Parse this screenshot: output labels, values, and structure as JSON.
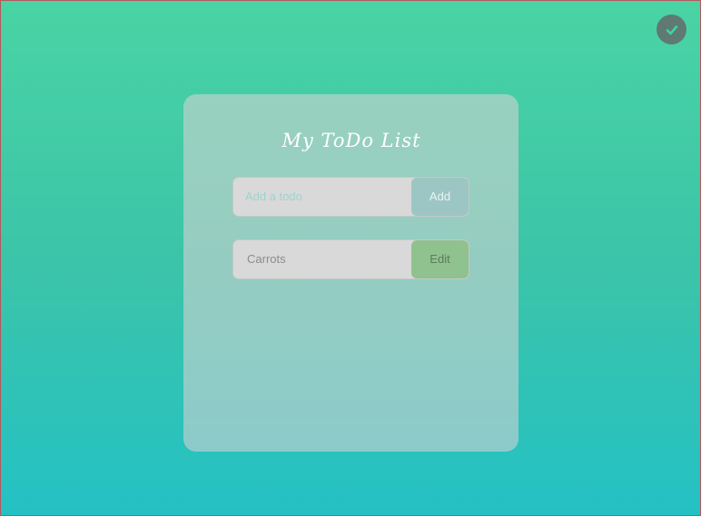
{
  "app": {
    "title": "My ToDo List"
  },
  "add_form": {
    "placeholder": "Add a todo",
    "value": "",
    "button_label": "Add"
  },
  "todos": [
    {
      "text": "Carrots",
      "edit_label": "Edit"
    }
  ],
  "corner_badge": {
    "icon": "check-icon"
  },
  "colors": {
    "gradient_top": "#4ad4a4",
    "gradient_bottom": "#24c1c4",
    "add_button": "#9cc6c4",
    "edit_button": "#8fc28e"
  }
}
